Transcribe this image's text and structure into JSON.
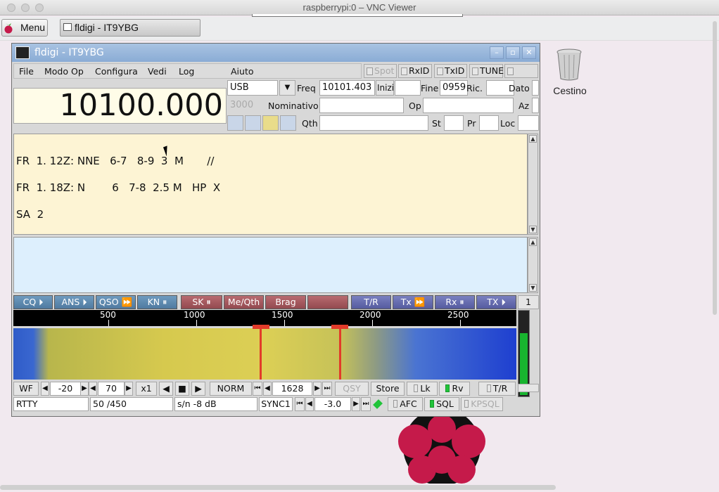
{
  "mac": {
    "title": "raspberrypi:0 – VNC Viewer"
  },
  "panel": {
    "menu": "Menu",
    "task": "fldigi - IT9YBG"
  },
  "desktop": {
    "trash": "Cestino"
  },
  "win": {
    "title": "fldigi - IT9YBG",
    "min": "–",
    "max": "▫",
    "close": "✕"
  },
  "menu": [
    "File",
    "Modo Op",
    "Configura",
    "Vedi",
    "Log",
    "Aiuto"
  ],
  "toggles": {
    "spot": "Spot",
    "rxid": "RxID",
    "txid": "TxID",
    "tune": "TUNE"
  },
  "freq": "10100.000",
  "mode": "USB",
  "freq_label": "Freq",
  "freq_value": "10101.403",
  "inizio": "Inizio",
  "fine": "Fine",
  "fine_value": "0959",
  "ric": "Ric.",
  "dato": "Dato",
  "bw": "3000",
  "nominativo": "Nominativo",
  "op": "Op",
  "az": "Az",
  "qth": "Qth",
  "st": "St",
  "pr": "Pr",
  "loc": "Loc",
  "rx_text": "FR  1. 12Z: NNE   6-7   8-9  3  M       //\nFR  1. 18Z: N        6   7-8  2.5 M   HP  X\nSA  2",
  "macros": [
    "CQ ⏵",
    "ANS ⏵",
    "QSO ⏩",
    "KN ⏸",
    "SK ⏸",
    "Me/Qth",
    "Brag",
    "",
    "T/R",
    "Tx ⏩",
    "Rx ⏸",
    "TX ⏵",
    "1"
  ],
  "scale": [
    "500",
    "1000",
    "1500",
    "2000",
    "2500"
  ],
  "ctl1": {
    "wf": "WF",
    "lo": "-20",
    "rng": "70",
    "x1": "x1",
    "norm": "NORM",
    "ptr": "1628",
    "qsy": "QSY",
    "store": "Store",
    "lk": "Lk",
    "rv": "Rv",
    "tr": "T/R"
  },
  "status": {
    "mode": "RTTY",
    "rate": "50 /450",
    "sn": "s/n -8  dB",
    "sync": "SYNC1",
    "val": "-3.0",
    "afc": "AFC",
    "sql": "SQL",
    "kpsql": "KPSQL"
  }
}
